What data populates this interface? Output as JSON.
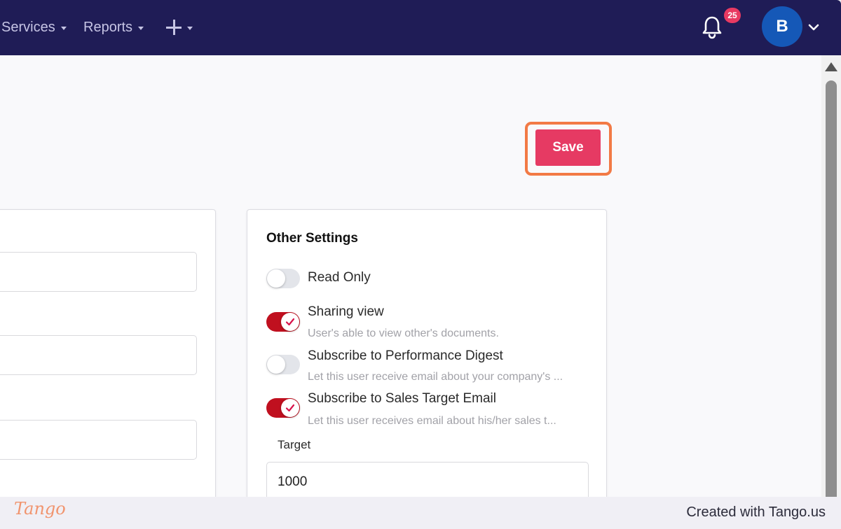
{
  "nav": {
    "items": [
      {
        "label": "Services"
      },
      {
        "label": "Reports"
      }
    ],
    "notifications_count": "25",
    "avatar_initial": "B"
  },
  "actions": {
    "save_label": "Save"
  },
  "other_settings": {
    "title": "Other Settings",
    "options": [
      {
        "label": "Read Only",
        "description": "",
        "enabled": false
      },
      {
        "label": "Sharing view",
        "description": "User's able to view other's documents.",
        "enabled": true
      },
      {
        "label": "Subscribe to Performance Digest",
        "description": "Let this user receive email about your company's ...",
        "enabled": false
      },
      {
        "label": "Subscribe to Sales Target Email",
        "description": "Let this user receives email about his/her sales t...",
        "enabled": true
      }
    ],
    "target_label": "Target",
    "target_value": "1000"
  },
  "footer": {
    "logo_text": "Tango",
    "credit": "Created with Tango.us"
  },
  "colors": {
    "nav_bg": "#1f1c56",
    "accent": "#e63a63",
    "toggle_on": "#c0101f",
    "highlight": "#f27a45",
    "avatar": "#1558b7"
  }
}
